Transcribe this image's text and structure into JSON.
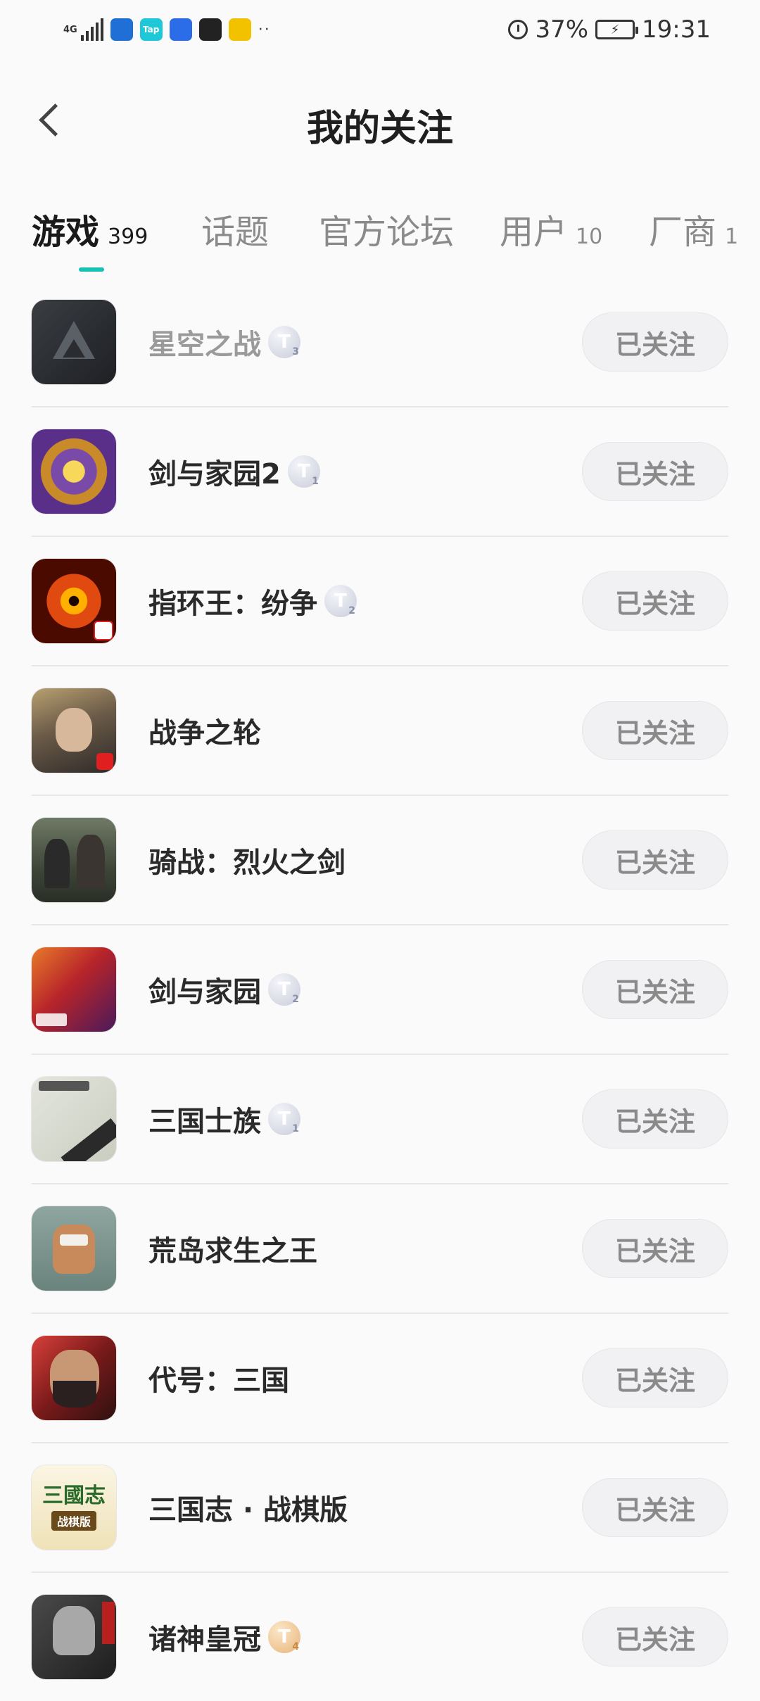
{
  "status_bar": {
    "network": "4G",
    "battery_percent": "37%",
    "time": "19:31",
    "app_icons": [
      {
        "name": "shield-app-icon",
        "color": "#1f6fd6",
        "glyph": ""
      },
      {
        "name": "taptap-app-icon",
        "color": "#1ec8d8",
        "glyph": "Tap"
      },
      {
        "name": "bulb-app-icon",
        "color": "#2b6de8",
        "glyph": ""
      },
      {
        "name": "qq-app-icon",
        "color": "#222222",
        "glyph": ""
      },
      {
        "name": "yellow-app-icon",
        "color": "#f2c200",
        "glyph": ""
      }
    ]
  },
  "header": {
    "title": "我的关注",
    "back_icon": "chevron-left-icon"
  },
  "tabs": [
    {
      "id": "games",
      "label": "游戏",
      "count": "399",
      "active": true
    },
    {
      "id": "topics",
      "label": "话题",
      "count": "",
      "active": false
    },
    {
      "id": "forums",
      "label": "官方论坛",
      "count": "",
      "active": false
    },
    {
      "id": "users",
      "label": "用户",
      "count": "10",
      "active": false
    },
    {
      "id": "vendors",
      "label": "厂商",
      "count": "1",
      "active": false
    }
  ],
  "accent_color": "#16c2b4",
  "follow_label": "已关注",
  "games": [
    {
      "name": "星空之战",
      "badge": "T",
      "badge_level": "3",
      "badge_tier": "silver",
      "dimmed": true,
      "icon": "dark"
    },
    {
      "name": "剑与家园2",
      "badge": "T",
      "badge_level": "1",
      "badge_tier": "silver",
      "dimmed": false,
      "icon": "gold"
    },
    {
      "name": "指环王：纷争",
      "badge": "T",
      "badge_level": "2",
      "badge_tier": "silver",
      "dimmed": false,
      "icon": "eye"
    },
    {
      "name": "战争之轮",
      "badge": "",
      "badge_level": "",
      "badge_tier": "",
      "dimmed": false,
      "icon": "warrior"
    },
    {
      "name": "骑战：烈火之剑",
      "badge": "",
      "badge_level": "",
      "badge_tier": "",
      "dimmed": false,
      "icon": "knight"
    },
    {
      "name": "剑与家园",
      "badge": "T",
      "badge_level": "2",
      "badge_tier": "silver",
      "dimmed": false,
      "icon": "dragon"
    },
    {
      "name": "三国士族",
      "badge": "T",
      "badge_level": "1",
      "badge_tier": "silver",
      "dimmed": false,
      "icon": "map"
    },
    {
      "name": "荒岛求生之王",
      "badge": "",
      "badge_level": "",
      "badge_tier": "",
      "dimmed": false,
      "icon": "tribe"
    },
    {
      "name": "代号：三国",
      "badge": "",
      "badge_level": "",
      "badge_tier": "",
      "dimmed": false,
      "icon": "general"
    },
    {
      "name": "三国志 · 战棋版",
      "badge": "",
      "badge_level": "",
      "badge_tier": "",
      "dimmed": false,
      "icon": "sgz",
      "icon_text_top": "三國志",
      "icon_text_bottom": "战棋版"
    },
    {
      "name": "诸神皇冠",
      "badge": "T",
      "badge_level": "4",
      "badge_tier": "bronze",
      "dimmed": false,
      "icon": "armor"
    }
  ]
}
